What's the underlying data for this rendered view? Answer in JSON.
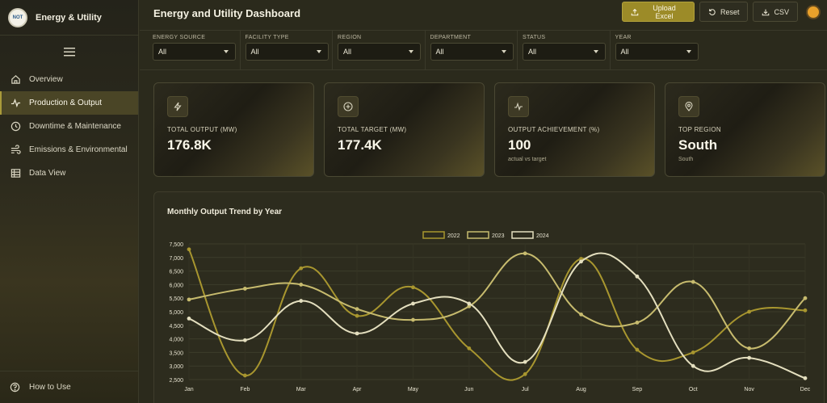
{
  "brand": {
    "logo_text": "NOT",
    "title": "Energy & Utility"
  },
  "sidebar": {
    "items": [
      {
        "label": "Overview",
        "icon": "home-icon"
      },
      {
        "label": "Production & Output",
        "icon": "pulse-icon"
      },
      {
        "label": "Downtime & Maintenance",
        "icon": "clock-icon"
      },
      {
        "label": "Emissions & Environmental",
        "icon": "wind-icon"
      },
      {
        "label": "Data View",
        "icon": "table-icon"
      }
    ],
    "help_label": "How to Use"
  },
  "header": {
    "title": "Energy and Utility Dashboard",
    "upload_label": "Upload Excel",
    "reset_label": "Reset",
    "csv_label": "CSV"
  },
  "filters": [
    {
      "label": "ENERGY SOURCE",
      "value": "All"
    },
    {
      "label": "FACILITY TYPE",
      "value": "All"
    },
    {
      "label": "REGION",
      "value": "All"
    },
    {
      "label": "DEPARTMENT",
      "value": "All"
    },
    {
      "label": "STATUS",
      "value": "All"
    },
    {
      "label": "YEAR",
      "value": "All"
    }
  ],
  "kpis": [
    {
      "label": "TOTAL OUTPUT (MW)",
      "value": "176.8K",
      "sub": "",
      "icon": "bolt-icon"
    },
    {
      "label": "TOTAL TARGET (MW)",
      "value": "177.4K",
      "sub": "",
      "icon": "target-icon"
    },
    {
      "label": "OUTPUT ACHIEVEMENT (%)",
      "value": "100",
      "sub": "actual vs target",
      "icon": "pulse-icon"
    },
    {
      "label": "TOP REGION",
      "value": "South",
      "sub": "South",
      "icon": "map-pin-icon"
    }
  ],
  "chart_title": "Monthly Output Trend by Year",
  "chart_data": {
    "type": "line",
    "title": "Monthly Output Trend by Year",
    "xlabel": "",
    "ylabel": "",
    "categories": [
      "Jan",
      "Feb",
      "Mar",
      "Apr",
      "May",
      "Jun",
      "Jul",
      "Aug",
      "Sep",
      "Oct",
      "Nov",
      "Dec"
    ],
    "ylim": [
      2500,
      7500
    ],
    "yticks": [
      2500,
      3000,
      3500,
      4000,
      4500,
      5000,
      5500,
      6000,
      6500,
      7000,
      7500
    ],
    "ytick_labels": [
      "2,500",
      "3,000",
      "3,500",
      "4,000",
      "4,500",
      "5,000",
      "5,500",
      "6,000",
      "6,500",
      "7,000",
      "7,500"
    ],
    "grid": true,
    "legend": "top-center",
    "series": [
      {
        "name": "2022",
        "color": "#a8962f",
        "values": [
          7300,
          2650,
          6600,
          4850,
          5900,
          3650,
          2700,
          6950,
          3600,
          3500,
          5000,
          5050
        ]
      },
      {
        "name": "2023",
        "color": "#c7bb6e",
        "values": [
          5450,
          5850,
          6000,
          5100,
          4700,
          5200,
          7150,
          4900,
          4600,
          6100,
          3650,
          5500
        ]
      },
      {
        "name": "2024",
        "color": "#e4dfbf",
        "values": [
          4750,
          3950,
          5400,
          4200,
          5300,
          5300,
          3150,
          6850,
          6300,
          3000,
          3300,
          2550
        ]
      }
    ]
  }
}
